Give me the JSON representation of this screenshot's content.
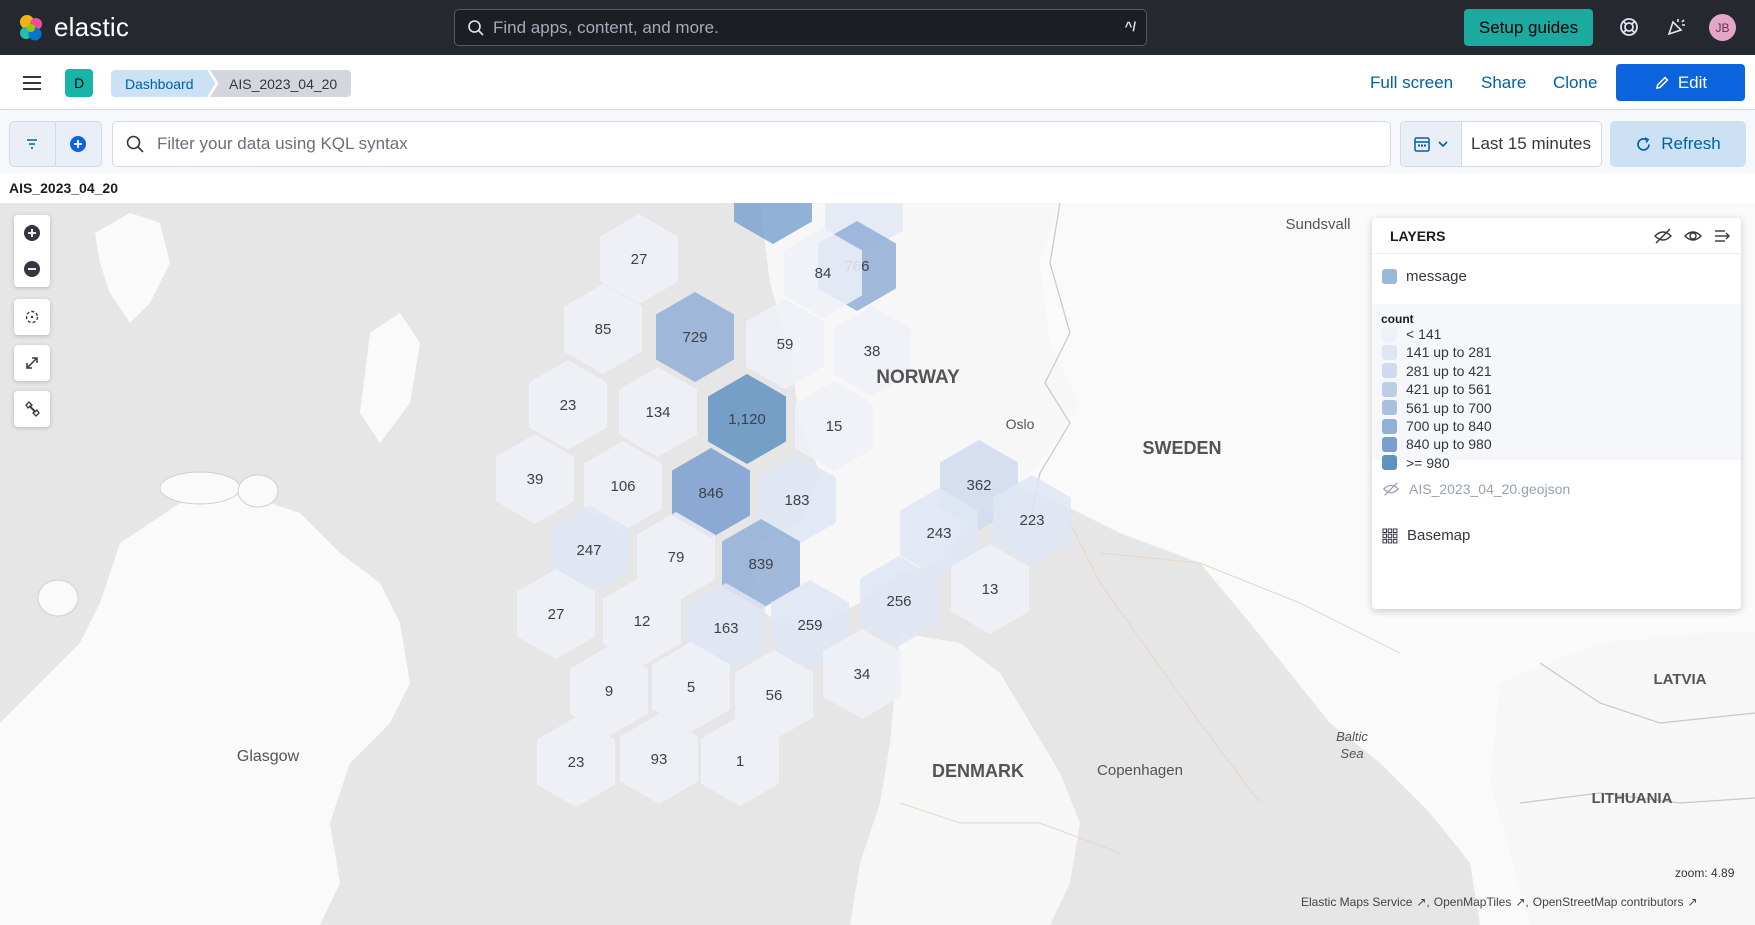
{
  "header": {
    "brand": "elastic",
    "search_placeholder": "Find apps, content, and more.",
    "search_shortcut": "^/",
    "setup_guides": "Setup guides",
    "avatar_initials": "JB"
  },
  "nav": {
    "space_initial": "D",
    "breadcrumbs": [
      "Dashboard",
      "AIS_2023_04_20"
    ],
    "full_screen": "Full screen",
    "share": "Share",
    "clone": "Clone",
    "edit": "Edit"
  },
  "query": {
    "placeholder": "Filter your data using KQL syntax",
    "time_range": "Last 15 minutes",
    "refresh": "Refresh"
  },
  "panel_title": "AIS_2023_04_20",
  "map": {
    "hex_counts": [
      "27",
      "766",
      "84",
      "85",
      "729",
      "59",
      "38",
      "23",
      "134",
      "1,120",
      "15",
      "39",
      "106",
      "846",
      "183",
      "362",
      "247",
      "79",
      "839",
      "243",
      "223",
      "27",
      "12",
      "163",
      "259",
      "256",
      "13",
      "9",
      "5",
      "56",
      "34",
      "23",
      "93",
      "1"
    ],
    "places": {
      "norway": "NORWAY",
      "sweden": "SWEDEN",
      "denmark": "DENMARK",
      "latvia": "LATVIA",
      "lithuania": "LITHUANIA",
      "sundsvall": "Sundsvall",
      "oslo": "Oslo",
      "glasgow": "Glasgow",
      "copenhagen": "Copenhagen",
      "baltic": "Baltic",
      "sea": "Sea"
    },
    "zoom": "zoom: 4.89",
    "attribution": [
      "Elastic Maps Service",
      "OpenMapTiles",
      "OpenStreetMap contributors"
    ]
  },
  "layers": {
    "title": "LAYERS",
    "message_layer": "message",
    "legend_title": "count",
    "legend_items": [
      {
        "label": "< 141",
        "color": "#eef1f8"
      },
      {
        "label": "141 up to 281",
        "color": "#dfe6f3"
      },
      {
        "label": "281 up to 421",
        "color": "#cfdaee"
      },
      {
        "label": "421 up to 561",
        "color": "#bccde7"
      },
      {
        "label": "561 up to 700",
        "color": "#a9bfe0"
      },
      {
        "label": "700 up to 840",
        "color": "#92afd7"
      },
      {
        "label": "840 up to 980",
        "color": "#7a9ecf"
      },
      {
        "label": ">= 980",
        "color": "#6092c0"
      }
    ],
    "geojson_layer": "AIS_2023_04_20.geojson",
    "basemap_layer": "Basemap"
  },
  "colors": {
    "header_bg": "#25282f",
    "accent_teal": "#1ba9a0",
    "primary_blue": "#0b64dd",
    "link_blue": "#0061a6"
  }
}
